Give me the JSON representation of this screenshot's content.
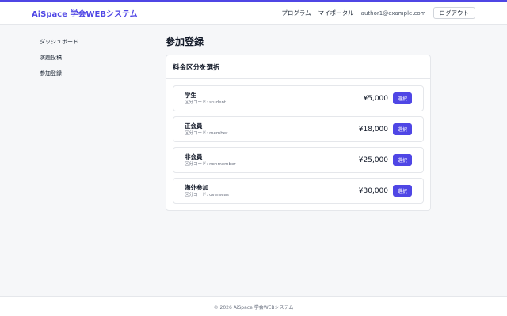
{
  "header": {
    "brand": "AiSpace 学会WEBシステム",
    "nav_program": "プログラム",
    "nav_myportal": "マイポータル",
    "user_email": "author1@example.com",
    "logout_label": "ログアウト"
  },
  "sidebar": {
    "items": [
      {
        "label": "ダッシュボード"
      },
      {
        "label": "演題投稿"
      },
      {
        "label": "参加登録"
      }
    ]
  },
  "main": {
    "title": "参加登録",
    "card_title": "料金区分を選択",
    "options": [
      {
        "name": "学生",
        "code": "区分コード: student",
        "price": "¥5,000",
        "button": "選択"
      },
      {
        "name": "正会員",
        "code": "区分コード: member",
        "price": "¥18,000",
        "button": "選択"
      },
      {
        "name": "非会員",
        "code": "区分コード: nonmember",
        "price": "¥25,000",
        "button": "選択"
      },
      {
        "name": "海外参加",
        "code": "区分コード: overseas",
        "price": "¥30,000",
        "button": "選択"
      }
    ]
  },
  "footer": {
    "text": "© 2026 AiSpace 学会WEBシステム"
  },
  "colors": {
    "accent": "#4f46e5",
    "background": "#f6f7f9"
  }
}
